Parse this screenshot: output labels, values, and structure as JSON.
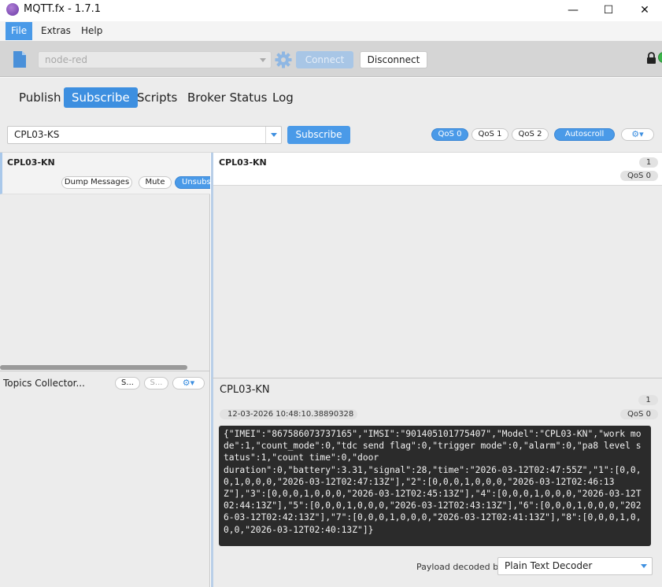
{
  "window": {
    "title": "MQTT.fx - 1.7.1",
    "controls": {
      "minimize": "—",
      "maximize": "☐",
      "close": "✕"
    }
  },
  "menu": {
    "items": [
      "File",
      "Extras",
      "Help"
    ],
    "active": "File"
  },
  "connection": {
    "profile": "node-red",
    "connect_label": "Connect",
    "disconnect_label": "Disconnect"
  },
  "tabs": {
    "items": [
      "Publish",
      "Subscribe",
      "Scripts",
      "Broker Status",
      "Log"
    ],
    "active": "Subscribe"
  },
  "subscribe": {
    "topic_value": "CPL03-KS",
    "subscribe_label": "Subscribe",
    "qos0": "QoS 0",
    "qos1": "QoS 1",
    "qos2": "QoS 2",
    "autoscroll": "Autoscroll",
    "active_qos": "QoS 0"
  },
  "subscriptions": {
    "items": [
      {
        "topic": "CPL03-KN",
        "dump_label": "Dump Messages",
        "mute_label": "Mute",
        "unsubscribe_label": "Unsubscribe"
      }
    ]
  },
  "topics_collector": {
    "label": "Topics Collector...",
    "btn1": "S...",
    "btn2": "S..."
  },
  "messages": {
    "items": [
      {
        "topic": "CPL03-KN",
        "number": "1",
        "qos": "QoS 0"
      }
    ]
  },
  "detail": {
    "topic": "CPL03-KN",
    "number": "1",
    "timestamp": "12-03-2026  10:48:10.38890328",
    "qos": "QoS 0",
    "payload": "{\"IMEI\":\"867586073737165\",\"IMSI\":\"901405101775407\",\"Model\":\"CPL03-KN\",\"work mode\":1,\"count_mode\":0,\"tdc send flag\":0,\"trigger mode\":0,\"alarm\":0,\"pa8 level status\":1,\"count time\":0,\"door\nduration\":0,\"battery\":3.31,\"signal\":28,\"time\":\"2026-03-12T02:47:55Z\",\"1\":[0,0,0,1,0,0,0,\"2026-03-12T02:47:13Z\"],\"2\":[0,0,0,1,0,0,0,\"2026-03-12T02:46:13Z\"],\"3\":[0,0,0,1,0,0,0,\"2026-03-12T02:45:13Z\"],\"4\":[0,0,0,1,0,0,0,\"2026-03-12T02:44:13Z\"],\"5\":[0,0,0,1,0,0,0,\"2026-03-12T02:43:13Z\"],\"6\":[0,0,0,1,0,0,0,\"2026-03-12T02:42:13Z\"],\"7\":[0,0,0,1,0,0,0,\"2026-03-12T02:41:13Z\"],\"8\":[0,0,0,1,0,0,0,\"2026-03-12T02:40:13Z\"]}",
    "decoder_label": "Payload decoded by",
    "decoder_value": "Plain Text Decoder"
  },
  "colors": {
    "accent": "#4a9ae8",
    "payload_bg": "#2b2b2b",
    "toolbar_bg": "#d5d5d5"
  },
  "icons": {
    "app": "mqttfx-app-icon",
    "profile": "document-icon",
    "settings": "gear-icon",
    "lock": "lock-icon",
    "status": "connection-status-icon"
  }
}
